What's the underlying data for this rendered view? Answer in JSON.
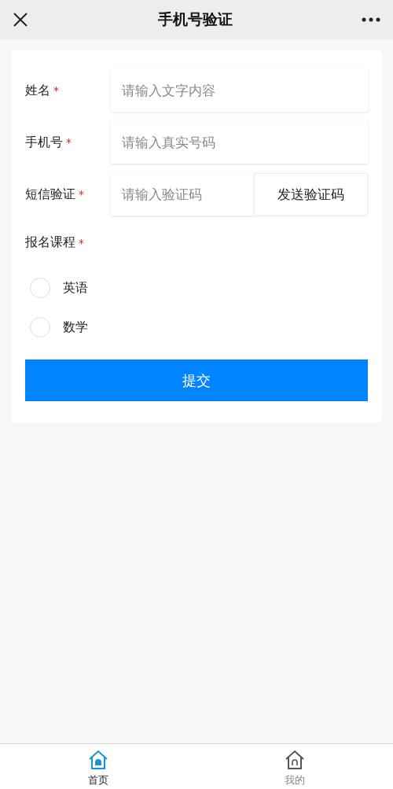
{
  "header": {
    "title": "手机号验证"
  },
  "form": {
    "fields": [
      {
        "label": "姓名",
        "required_mark": "*",
        "placeholder": "请输入文字内容"
      },
      {
        "label": "手机号",
        "required_mark": "*",
        "placeholder": "请输入真实号码"
      },
      {
        "label": "短信验证",
        "required_mark": "*",
        "placeholder": "请输入验证码",
        "button": "发送验证码"
      }
    ],
    "course": {
      "label": "报名课程",
      "required_mark": "*",
      "options": [
        {
          "label": "英语",
          "selected": false
        },
        {
          "label": "数学",
          "selected": false
        }
      ]
    },
    "submit": "提交"
  },
  "tab_bar": [
    {
      "label": "首页",
      "selected": true
    },
    {
      "label": "我的",
      "selected": false
    }
  ]
}
